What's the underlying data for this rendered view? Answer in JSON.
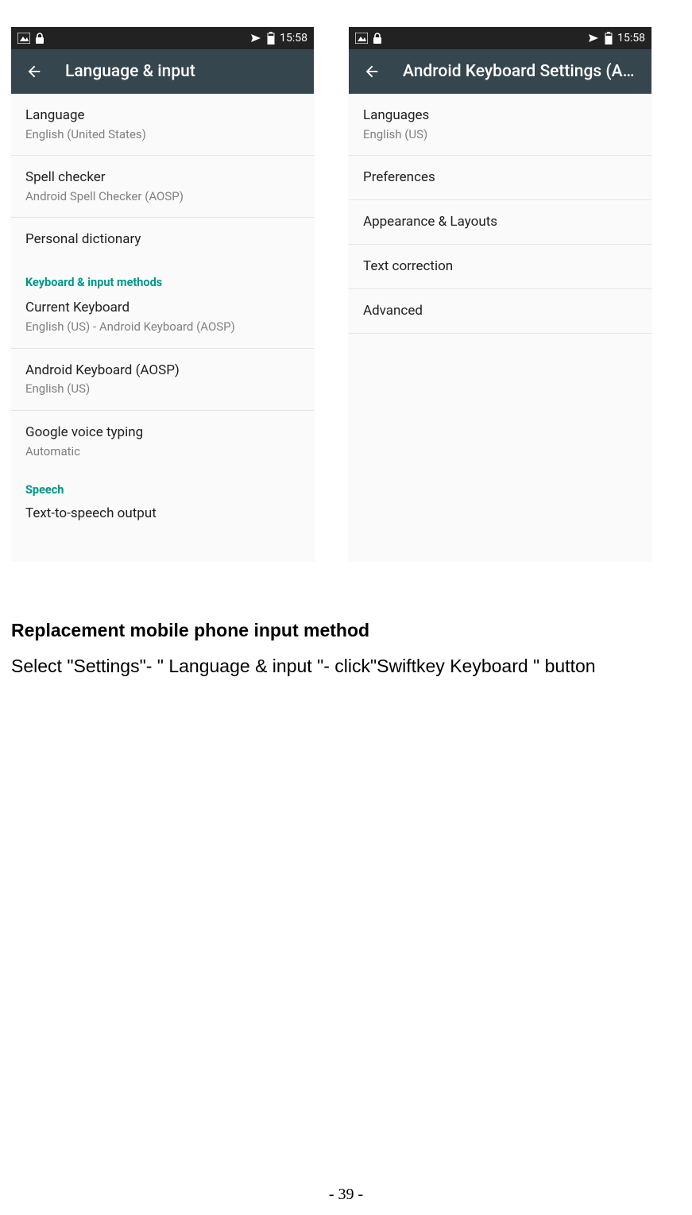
{
  "status": {
    "time": "15:58"
  },
  "screen_left": {
    "title": "Language & input",
    "items": [
      {
        "title": "Language",
        "subtitle": "English (United States)"
      },
      {
        "title": "Spell checker",
        "subtitle": "Android Spell Checker (AOSP)"
      },
      {
        "title": "Personal dictionary",
        "subtitle": ""
      }
    ],
    "section1_header": "Keyboard & input methods",
    "section1_items": [
      {
        "title": "Current Keyboard",
        "subtitle": "English (US) - Android Keyboard (AOSP)"
      },
      {
        "title": "Android Keyboard (AOSP)",
        "subtitle": "English (US)"
      },
      {
        "title": "Google voice typing",
        "subtitle": "Automatic"
      }
    ],
    "section2_header": "Speech",
    "section2_items": [
      {
        "title": "Text-to-speech output",
        "subtitle": ""
      }
    ]
  },
  "screen_right": {
    "title": "Android Keyboard Settings (A…",
    "items": [
      {
        "title": "Languages",
        "subtitle": "English (US)"
      },
      {
        "title": "Preferences",
        "subtitle": ""
      },
      {
        "title": "Appearance & Layouts",
        "subtitle": ""
      },
      {
        "title": "Text correction",
        "subtitle": ""
      },
      {
        "title": "Advanced",
        "subtitle": ""
      }
    ]
  },
  "doc": {
    "heading": "Replacement mobile phone input method",
    "body": "Select \"Settings\"- \" Language & input \"- click\"Swiftkey Keyboard \" button",
    "page_number": "- 39 -"
  }
}
